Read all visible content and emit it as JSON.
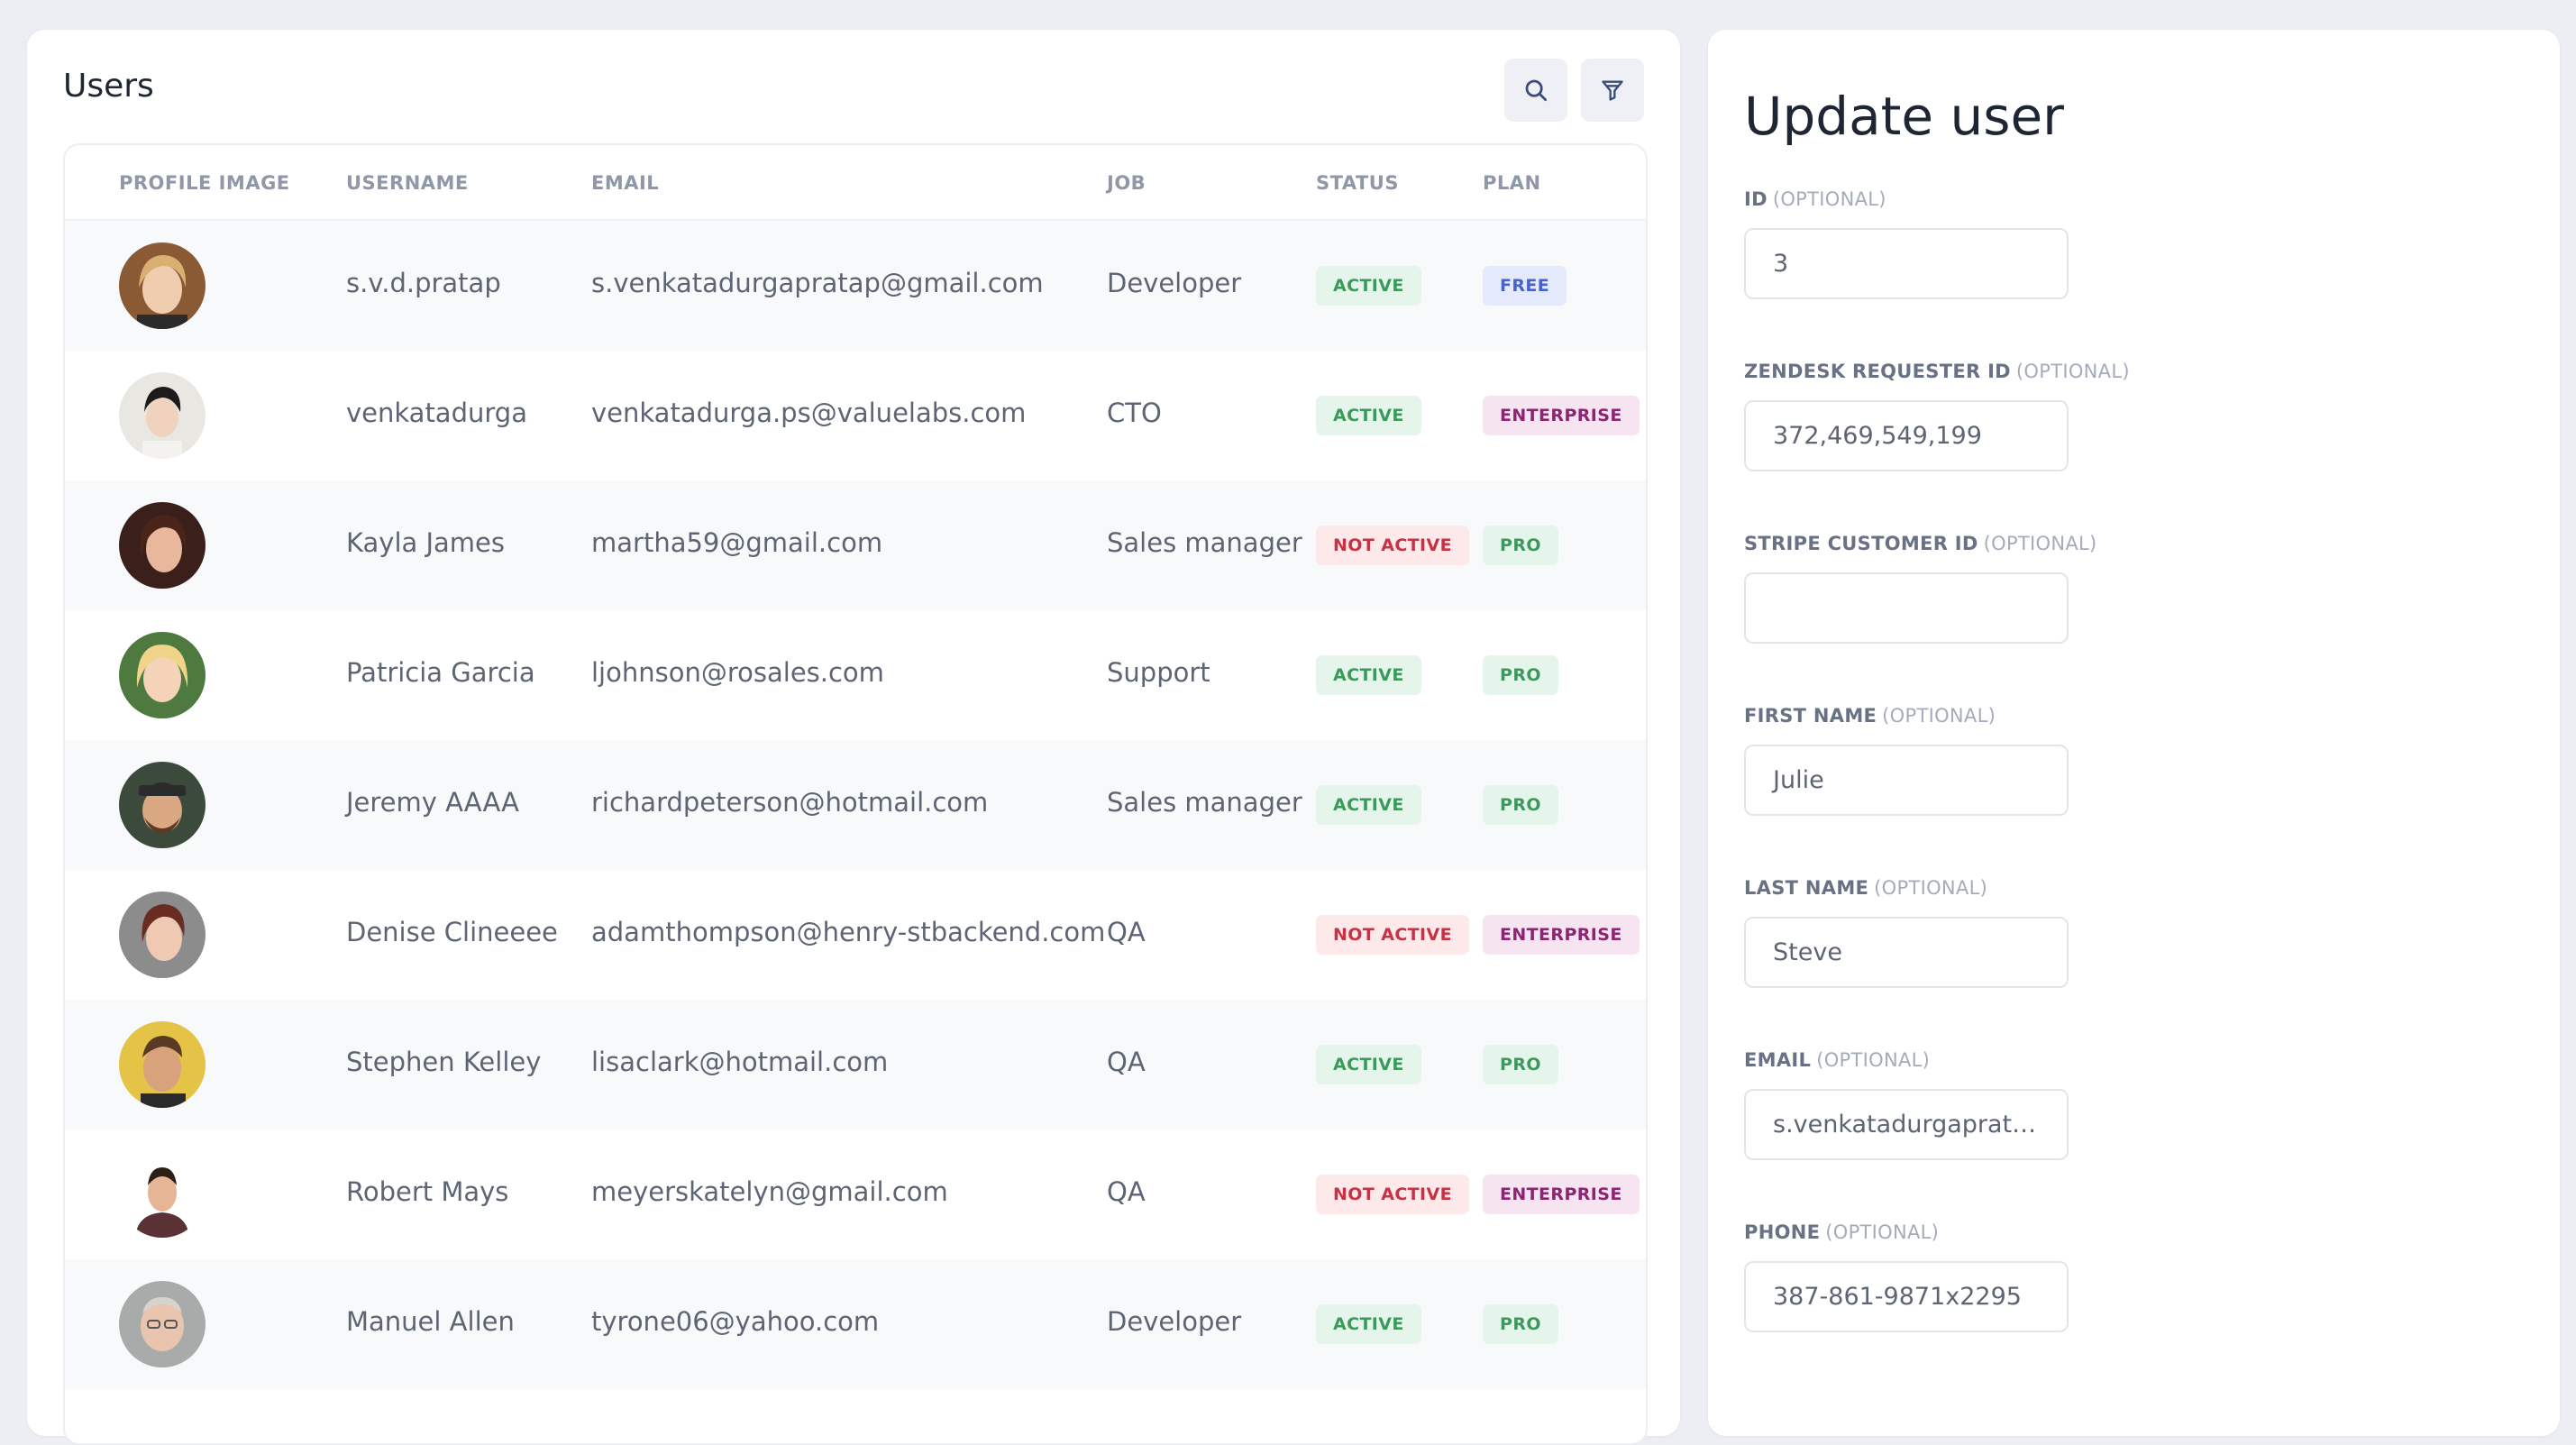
{
  "users_panel": {
    "title": "Users",
    "search_icon": "search-icon",
    "filter_icon": "filter-icon",
    "columns": [
      "PROFILE IMAGE",
      "USERNAME",
      "EMAIL",
      "JOB",
      "STATUS",
      "PLAN"
    ],
    "rows": [
      {
        "username": "s.v.d.pratap",
        "email": "s.venkatadurgapratap@gmail.com",
        "job": "Developer",
        "status": "ACTIVE",
        "plan": "FREE"
      },
      {
        "username": "venkatadurga",
        "email": "venkatadurga.ps@valuelabs.com",
        "job": "CTO",
        "status": "ACTIVE",
        "plan": "ENTERPRISE"
      },
      {
        "username": "Kayla James",
        "email": "martha59@gmail.com",
        "job": "Sales manager",
        "status": "NOT ACTIVE",
        "plan": "PRO"
      },
      {
        "username": "Patricia Garcia",
        "email": "ljohnson@rosales.com",
        "job": "Support",
        "status": "ACTIVE",
        "plan": "PRO"
      },
      {
        "username": "Jeremy AAAA",
        "email": "richardpeterson@hotmail.com",
        "job": "Sales manager",
        "status": "ACTIVE",
        "plan": "PRO"
      },
      {
        "username": "Denise Clineeee",
        "email": "adamthompson@henry-stbackend.com",
        "job": "QA",
        "status": "NOT ACTIVE",
        "plan": "ENTERPRISE"
      },
      {
        "username": "Stephen Kelley",
        "email": "lisaclark@hotmail.com",
        "job": "QA",
        "status": "ACTIVE",
        "plan": "PRO"
      },
      {
        "username": "Robert Mays",
        "email": "meyerskatelyn@gmail.com",
        "job": "QA",
        "status": "NOT ACTIVE",
        "plan": "ENTERPRISE"
      },
      {
        "username": "Manuel Allen",
        "email": "tyrone06@yahoo.com",
        "job": "Developer",
        "status": "ACTIVE",
        "plan": "PRO"
      }
    ]
  },
  "update_panel": {
    "title": "Update user",
    "optional_tag": "(OPTIONAL)",
    "fields": [
      {
        "label": "ID",
        "value": "3"
      },
      {
        "label": "ZENDESK REQUESTER ID",
        "value": "372,469,549,199"
      },
      {
        "label": "STRIPE CUSTOMER ID",
        "value": ""
      },
      {
        "label": "FIRST NAME",
        "value": "Julie"
      },
      {
        "label": "LAST NAME",
        "value": "Steve"
      },
      {
        "label": "EMAIL",
        "value": "s.venkatadurgapratap@gmail.com"
      },
      {
        "label": "PHONE",
        "value": "387-861-9871x2295"
      }
    ]
  },
  "colors": {
    "background": "#eceef3",
    "active_badge": "#3a9a5b",
    "not_active_badge": "#c73344",
    "free_badge": "#4862c8",
    "enterprise_badge": "#8b2472"
  }
}
